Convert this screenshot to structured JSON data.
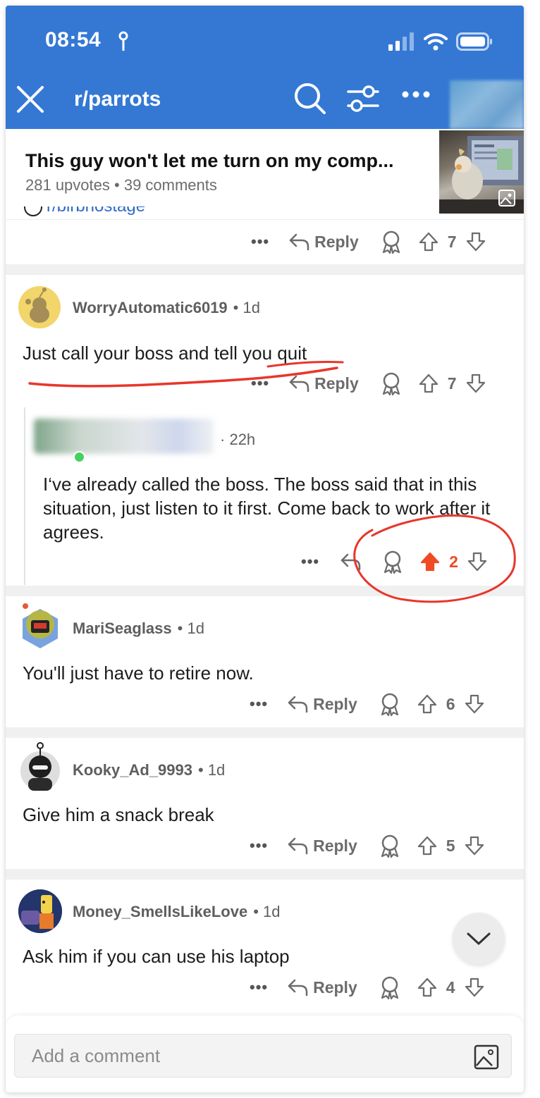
{
  "status_bar": {
    "time": "08:54"
  },
  "nav": {
    "title": "r/parrots"
  },
  "post": {
    "title": "This guy won't let me turn on my comp...",
    "upvotes": "281 upvotes",
    "comments": "39 comments",
    "meta_separator": "•"
  },
  "scrolled_comment": {
    "partial_text": "r/birbhostage",
    "votes": "7"
  },
  "reply_label": "Reply",
  "comments": [
    {
      "author": "WorryAutomatic6019",
      "age": "1d",
      "text": "Just call your boss and tell you quit",
      "votes": "7"
    },
    {
      "author_hidden": true,
      "age": "22h",
      "text": "I‘ve already called the boss. The boss said that in this situation, just listen to it first. Come back to work after it agrees.",
      "votes": "2",
      "upvoted": true
    },
    {
      "author": "MariSeaglass",
      "age": "1d",
      "text": "You'll just have to retire now.",
      "votes": "6"
    },
    {
      "author": "Kooky_Ad_9993",
      "age": "1d",
      "text": "Give him a snack break",
      "votes": "5"
    },
    {
      "author": "Money_SmellsLikeLove",
      "age": "1d",
      "text": "Ask him if you can use his laptop",
      "votes": "4"
    }
  ],
  "composer": {
    "placeholder": "Add a comment"
  },
  "colors": {
    "header_blue": "#3478d4",
    "upvote_orange": "#ef4a23",
    "annotation_red": "#e8362b"
  },
  "icons": [
    "close-icon",
    "search-icon",
    "filter-icon",
    "more-icon",
    "reply-icon",
    "award-icon",
    "upvote-icon",
    "downvote-icon",
    "chevron-down-icon",
    "image-icon"
  ]
}
